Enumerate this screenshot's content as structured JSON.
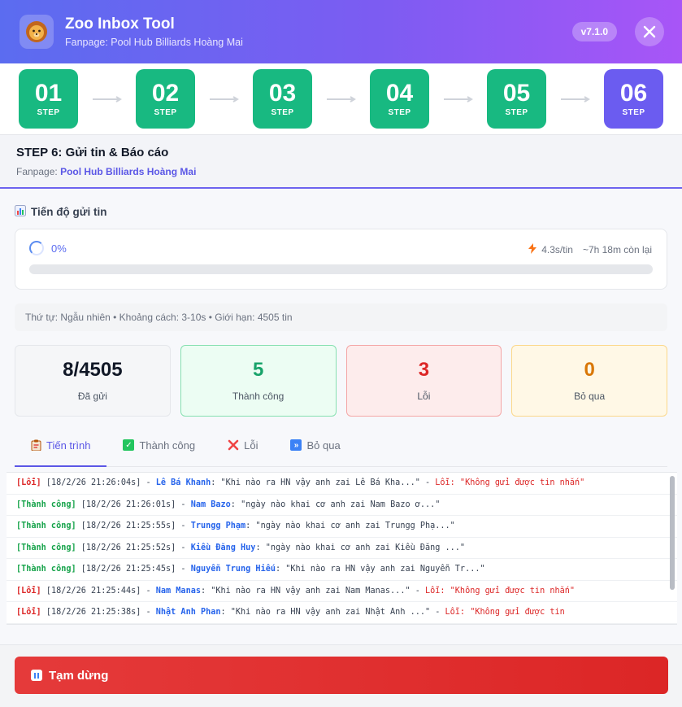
{
  "header": {
    "title": "Zoo Inbox Tool",
    "subtitle": "Fanpage: Pool Hub Billiards Hoàng Mai",
    "version": "v7.1.0"
  },
  "steps": [
    {
      "num": "01",
      "label": "STEP"
    },
    {
      "num": "02",
      "label": "STEP"
    },
    {
      "num": "03",
      "label": "STEP"
    },
    {
      "num": "04",
      "label": "STEP"
    },
    {
      "num": "05",
      "label": "STEP"
    },
    {
      "num": "06",
      "label": "STEP"
    }
  ],
  "step_panel": {
    "title": "STEP 6: Gửi tin & Báo cáo",
    "fanpage_label": "Fanpage:",
    "fanpage_name": "Pool Hub Billiards Hoàng Mai"
  },
  "progress": {
    "section_title": "Tiến độ gửi tin",
    "percent": "0%",
    "percent_value": 0,
    "speed": "4.3s/tin",
    "remaining": "~7h 18m còn lại"
  },
  "info_line": "Thứ tự: Ngẫu nhiên • Khoảng cách: 3-10s • Giới hạn: 4505 tin",
  "stats": {
    "sent": {
      "value": "8/4505",
      "label": "Đã gửi"
    },
    "success": {
      "value": "5",
      "label": "Thành công"
    },
    "error": {
      "value": "3",
      "label": "Lỗi"
    },
    "skipped": {
      "value": "0",
      "label": "Bỏ qua"
    }
  },
  "tabs": [
    {
      "label": "Tiến trình",
      "icon": "clipboard-icon"
    },
    {
      "label": "Thành công",
      "icon": "check-icon"
    },
    {
      "label": "Lỗi",
      "icon": "x-icon"
    },
    {
      "label": "Bỏ qua",
      "icon": "skip-icon"
    }
  ],
  "log": [
    {
      "tag": "[Lỗi]",
      "status": "error",
      "time": "[18/2/26 21:26:04s]",
      "name": "Lê Bá Khanh",
      "msg": "\"Khi nào ra HN vậy anh zai Lê Bá Kha...\"",
      "err": "Lỗi: \"Không gửi được tin nhắn\""
    },
    {
      "tag": "[Thành công]",
      "status": "success",
      "time": "[18/2/26 21:26:01s]",
      "name": "Nam Bazo",
      "msg": "\"ngày nào khai cơ anh zai Nam Bazo ơ...\"",
      "err": ""
    },
    {
      "tag": "[Thành công]",
      "status": "success",
      "time": "[18/2/26 21:25:55s]",
      "name": "Trungg Phạm",
      "msg": "\"ngày nào khai cơ anh zai Trungg Phạ...\"",
      "err": ""
    },
    {
      "tag": "[Thành công]",
      "status": "success",
      "time": "[18/2/26 21:25:52s]",
      "name": "Kiều Đăng Huy",
      "msg": "\"ngày nào khai cơ anh zai Kiều Đăng ...\"",
      "err": ""
    },
    {
      "tag": "[Thành công]",
      "status": "success",
      "time": "[18/2/26 21:25:45s]",
      "name": "Nguyễn Trung Hiếu",
      "msg": "\"Khi nào ra HN vậy anh zai Nguyễn Tr...\"",
      "err": ""
    },
    {
      "tag": "[Lỗi]",
      "status": "error",
      "time": "[18/2/26 21:25:44s]",
      "name": "Nam Manas",
      "msg": "\"Khi nào ra HN vậy anh zai Nam Manas...\"",
      "err": "Lỗi: \"Không gửi được tin nhắn\""
    },
    {
      "tag": "[Lỗi]",
      "status": "error",
      "time": "[18/2/26 21:25:38s]",
      "name": "Nhật Anh Phan",
      "msg": "\"Khi nào ra HN vậy anh zai Nhật Anh ...\"",
      "err": "Lỗi: \"Không gửi được tin"
    }
  ],
  "pause_button": "Tạm dừng",
  "colors": {
    "primary": "#5b6cf0",
    "step_done": "#18b981",
    "step_active": "#6b5cf0",
    "danger": "#dc2626"
  }
}
